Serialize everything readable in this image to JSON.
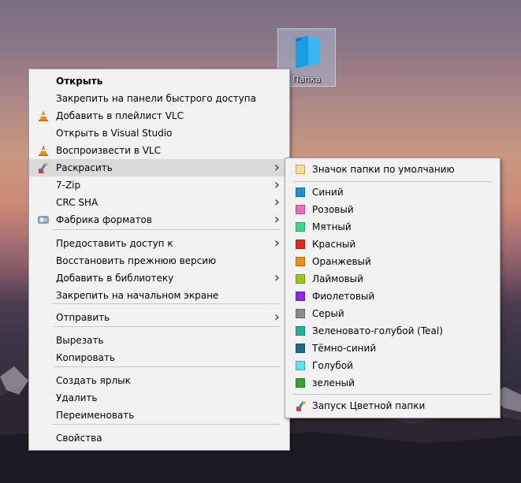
{
  "desktop": {
    "folder_label": "Папка"
  },
  "main_menu": [
    {
      "label": "Открыть",
      "bold": true,
      "icon": null,
      "arrow": false
    },
    {
      "label": "Закрепить на панели быстрого доступа",
      "icon": null,
      "arrow": false
    },
    {
      "label": "Добавить в плейлист VLC",
      "icon": "vlc-icon",
      "arrow": false
    },
    {
      "label": "Открыть в Visual Studio",
      "icon": null,
      "arrow": false
    },
    {
      "label": "Воспроизвести в VLC",
      "icon": "vlc-icon",
      "arrow": false
    },
    {
      "label": "Раскрасить",
      "icon": "paintbrush-icon",
      "arrow": true,
      "highlighted": true
    },
    {
      "label": "7-Zip",
      "icon": null,
      "arrow": true
    },
    {
      "label": "CRC SHA",
      "icon": null,
      "arrow": true
    },
    {
      "label": "Фабрика форматов",
      "icon": "format-factory-icon",
      "arrow": true
    },
    {
      "label": "Предоставить доступ к",
      "icon": null,
      "arrow": true
    },
    {
      "label": "Восстановить прежнюю версию",
      "icon": null,
      "arrow": false
    },
    {
      "label": "Добавить в библиотеку",
      "icon": null,
      "arrow": true
    },
    {
      "label": "Закрепить на начальном экране",
      "icon": null,
      "arrow": false
    },
    {
      "label": "Отправить",
      "icon": null,
      "arrow": true
    },
    {
      "label": "Вырезать",
      "icon": null,
      "arrow": false
    },
    {
      "label": "Копировать",
      "icon": null,
      "arrow": false
    },
    {
      "label": "Создать ярлык",
      "icon": null,
      "arrow": false
    },
    {
      "label": "Удалить",
      "icon": null,
      "arrow": false
    },
    {
      "label": "Переименовать",
      "icon": null,
      "arrow": false
    },
    {
      "label": "Свойства",
      "icon": null,
      "arrow": false
    }
  ],
  "sub_menu": {
    "default": {
      "label": "Значок папки по умолчанию",
      "color": "#f9e08a"
    },
    "colors": [
      {
        "label": "Синий",
        "color": "#1e90d6"
      },
      {
        "label": "Розовый",
        "color": "#f06ac0"
      },
      {
        "label": "Мятный",
        "color": "#3ed68a"
      },
      {
        "label": "Красный",
        "color": "#e0281e"
      },
      {
        "label": "Оранжевый",
        "color": "#f09010"
      },
      {
        "label": "Лаймовый",
        "color": "#9cc814"
      },
      {
        "label": "Фиолетовый",
        "color": "#8a2be2"
      },
      {
        "label": "Серый",
        "color": "#8c8c8c"
      },
      {
        "label": "Зеленовато-голубой (Teal)",
        "color": "#1eb49c"
      },
      {
        "label": "Тёмно-синий",
        "color": "#1a6e8a"
      },
      {
        "label": "Голубой",
        "color": "#5ee0f0"
      },
      {
        "label": "зеленый",
        "color": "#2ea82e"
      }
    ],
    "launch": {
      "label": "Запуск Цветной папки",
      "icon": "paintbrush-icon"
    }
  }
}
